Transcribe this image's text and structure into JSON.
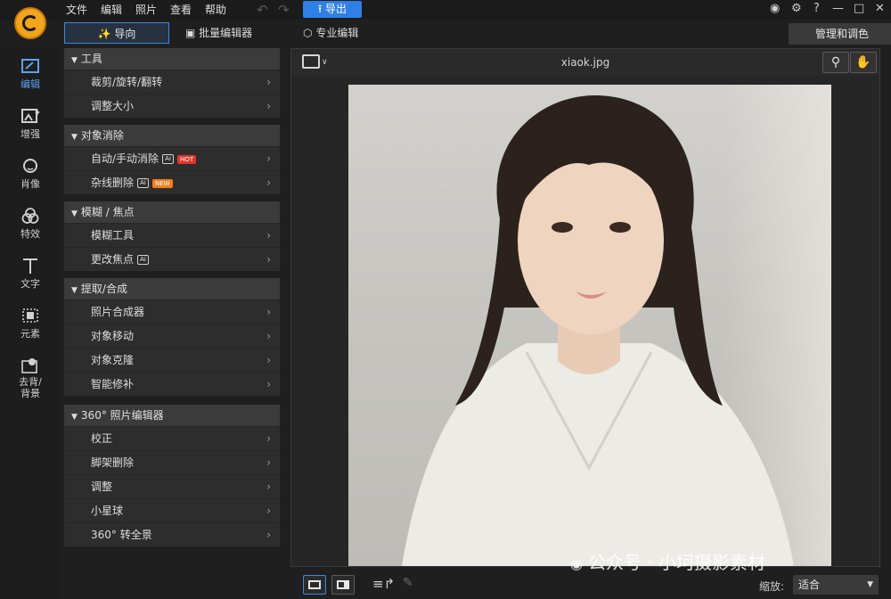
{
  "menu": {
    "items": [
      "文件",
      "编辑",
      "照片",
      "查看",
      "帮助"
    ],
    "export_label": "导出",
    "help_label": "?"
  },
  "modes": {
    "guide": "导向",
    "batch": "批量编辑器",
    "pro": "专业编辑",
    "manage": "管理和调色"
  },
  "rail": {
    "items": [
      {
        "label": "编辑",
        "icon": "edit-icon"
      },
      {
        "label": "增强",
        "icon": "enhance-icon"
      },
      {
        "label": "肖像",
        "icon": "portrait-icon"
      },
      {
        "label": "特效",
        "icon": "effects-icon"
      },
      {
        "label": "文字",
        "icon": "text-icon"
      },
      {
        "label": "元素",
        "icon": "elements-icon"
      },
      {
        "label": "去背/背景",
        "icon": "remove-bg-icon"
      }
    ]
  },
  "groups": [
    {
      "title": "工具",
      "items": [
        {
          "label": "裁剪/旋转/翻转"
        },
        {
          "label": "调整大小"
        }
      ]
    },
    {
      "title": "对象消除",
      "items": [
        {
          "label": "自动/手动消除",
          "ai": true,
          "badge": "HOT"
        },
        {
          "label": "杂线删除",
          "ai": true,
          "badge": "NEW"
        }
      ]
    },
    {
      "title": "模糊 / 焦点",
      "items": [
        {
          "label": "模糊工具"
        },
        {
          "label": "更改焦点",
          "ai": true
        }
      ]
    },
    {
      "title": "提取/合成",
      "items": [
        {
          "label": "照片合成器"
        },
        {
          "label": "对象移动"
        },
        {
          "label": "对象克隆"
        },
        {
          "label": "智能修补"
        }
      ]
    },
    {
      "title": "360° 照片编辑器",
      "items": [
        {
          "label": "校正"
        },
        {
          "label": "脚架删除"
        },
        {
          "label": "调整"
        },
        {
          "label": "小星球"
        },
        {
          "label": "360° 转全景"
        }
      ]
    }
  ],
  "viewer": {
    "filename": "xiaok.jpg"
  },
  "bottom": {
    "zoom_label": "缩放:",
    "zoom_value": "适合"
  },
  "watermark": "公众号 · 小坷摄影素材",
  "colors": {
    "accent": "#2f7fe6",
    "active_rail": "#5aa2f5",
    "hot": "#e0352b",
    "new": "#f07d1d"
  }
}
